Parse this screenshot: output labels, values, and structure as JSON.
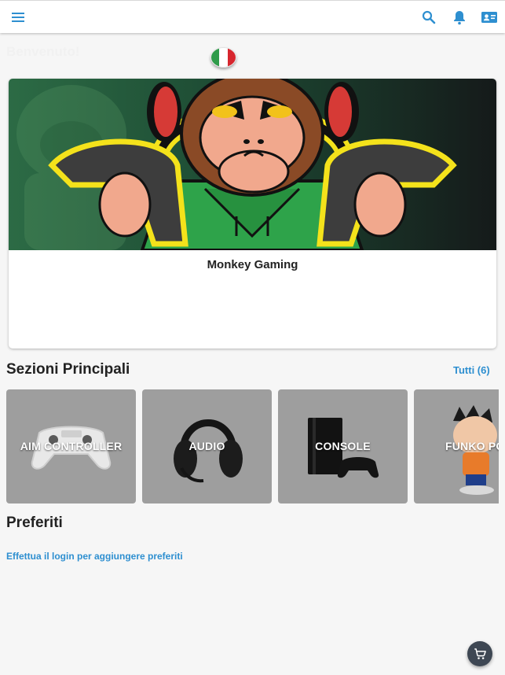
{
  "header": {
    "menu_icon": "hamburger-menu-icon",
    "search_icon": "search-icon",
    "notifications_icon": "bell-icon",
    "account_icon": "contact-card-icon",
    "accent_color": "#2e8fd0"
  },
  "welcome": {
    "text": "Benvenuto!"
  },
  "language": {
    "flag": "italy-flag",
    "colors": [
      "#2f9b4a",
      "#ffffff",
      "#d7262e"
    ]
  },
  "featured": {
    "title": "Monkey Gaming",
    "image": "monkey-gaming-mascot"
  },
  "main_sections": {
    "title": "Sezioni Principali",
    "see_all": "Tutti (6)",
    "items": [
      {
        "label": "AIM CONTROLLER",
        "image": "white-gamepad"
      },
      {
        "label": "AUDIO",
        "image": "gaming-headset"
      },
      {
        "label": "CONSOLE",
        "image": "playstation-console"
      },
      {
        "label": "FUNKO POP",
        "image": "funko-figure"
      }
    ]
  },
  "favorites": {
    "title": "Preferiti",
    "login_prompt": "Effettua il login per aggiungere preferiti"
  },
  "cart": {
    "icon": "cart-icon"
  }
}
